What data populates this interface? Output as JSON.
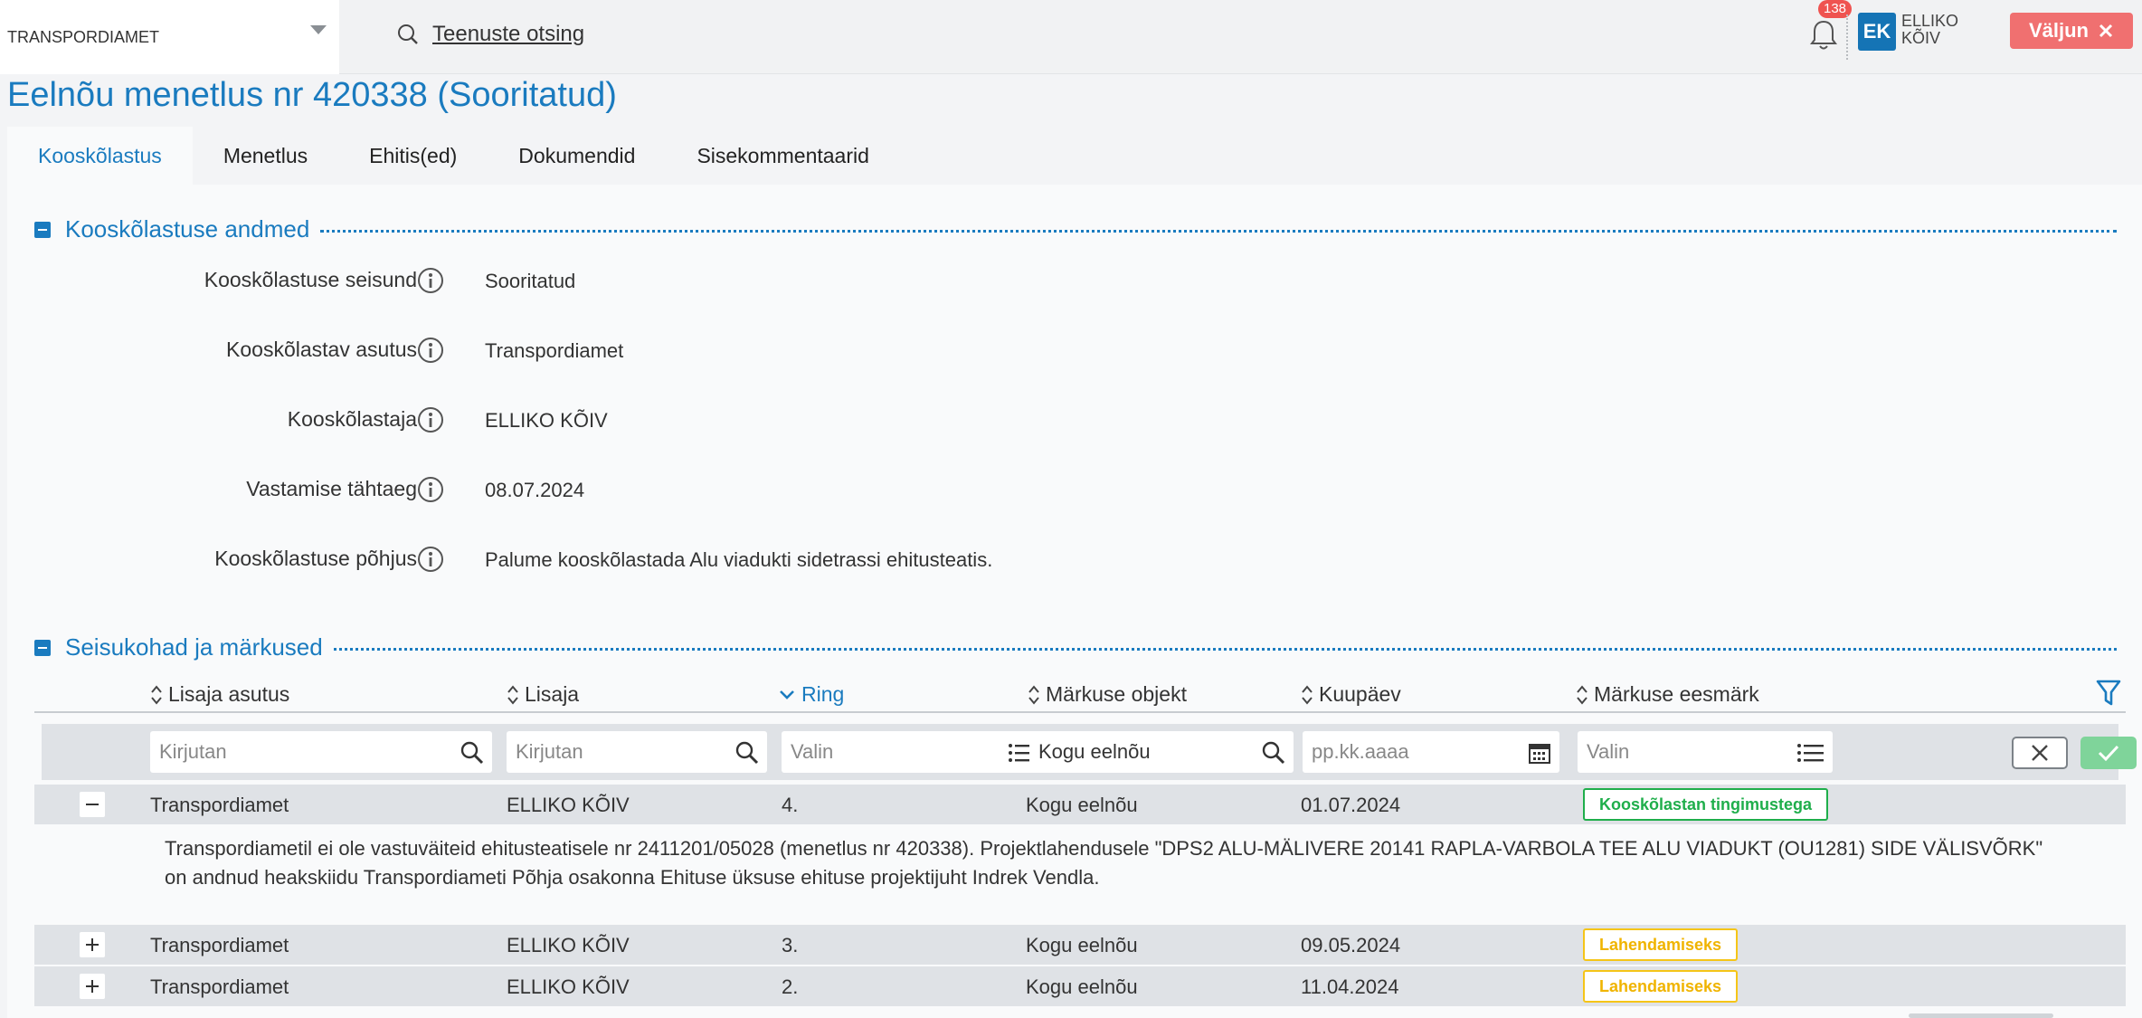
{
  "header": {
    "org_select": "TRANSPORDIAMET",
    "search_label": "Teenuste otsing",
    "notification_count": "138",
    "user_initials": "EK",
    "user_name_line1": "ELLIKO",
    "user_name_line2": "KÕIV",
    "logout_label": "Väljun"
  },
  "page": {
    "title": "Eelnõu menetlus nr 420338 (Sooritatud)"
  },
  "tabs": [
    {
      "label": "Kooskõlastus",
      "active": true
    },
    {
      "label": "Menetlus",
      "active": false
    },
    {
      "label": "Ehitis(ed)",
      "active": false
    },
    {
      "label": "Dokumendid",
      "active": false
    },
    {
      "label": "Sisekommentaarid",
      "active": false
    }
  ],
  "section1": {
    "title": "Kooskõlastuse andmed",
    "fields": [
      {
        "label": "Kooskõlastuse seisund",
        "value": "Sooritatud"
      },
      {
        "label": "Kooskõlastav asutus",
        "value": "Transpordiamet"
      },
      {
        "label": "Kooskõlastaja",
        "value": "ELLIKO KÕIV"
      },
      {
        "label": "Vastamise tähtaeg",
        "value": "08.07.2024"
      },
      {
        "label": "Kooskõlastuse põhjus",
        "value": "Palume kooskõlastada Alu viadukti sidetrassi ehitusteatis."
      }
    ]
  },
  "section2": {
    "title": "Seisukohad ja märkused",
    "columns": [
      {
        "label": "Lisaja asutus",
        "sort": "none"
      },
      {
        "label": "Lisaja",
        "sort": "none"
      },
      {
        "label": "Ring",
        "sort": "desc"
      },
      {
        "label": "Märkuse objekt",
        "sort": "none"
      },
      {
        "label": "Kuupäev",
        "sort": "none"
      },
      {
        "label": "Märkuse eesmärk",
        "sort": "none"
      }
    ],
    "filters": {
      "lisaja_asutus": "Kirjutan",
      "lisaja": "Kirjutan",
      "ring": "Valin",
      "objekt": "Kogu eelnõu",
      "kuupaev": "pp.kk.aaaa",
      "eesmark": "Valin"
    },
    "rows": [
      {
        "expanded": true,
        "asutus": "Transpordiamet",
        "lisaja": "ELLIKO KÕIV",
        "ring": "4.",
        "objekt": "Kogu eelnõu",
        "kuupaev": "01.07.2024",
        "eesmark": "Kooskõlastan tingimustega",
        "tag_color": "green"
      },
      {
        "expanded": false,
        "asutus": "Transpordiamet",
        "lisaja": "ELLIKO KÕIV",
        "ring": "3.",
        "objekt": "Kogu eelnõu",
        "kuupaev": "09.05.2024",
        "eesmark": "Lahendamiseks",
        "tag_color": "yellow"
      },
      {
        "expanded": false,
        "asutus": "Transpordiamet",
        "lisaja": "ELLIKO KÕIV",
        "ring": "2.",
        "objekt": "Kogu eelnõu",
        "kuupaev": "11.04.2024",
        "eesmark": "Lahendamiseks",
        "tag_color": "yellow"
      }
    ],
    "detail_line1": "Transpordiametil ei ole vastuväiteid ehitusteatisele nr 2411201/05028 (menetlus nr 420338). Projektlahendusele \"DPS2 ALU-MÄLIVERE 20141 RAPLA-VARBOLA TEE ALU VIADUKT (OU1281) SIDE VÄLISVÕRK\"",
    "detail_line2": "on andnud heakskiidu Transpordiameti Põhja osakonna Ehituse üksuse ehituse projektijuht Indrek Vendla."
  },
  "colors": {
    "accent": "#1a7bbf",
    "logout": "#f07070",
    "tag_green": "#1fae4b",
    "tag_yellow": "#f5c518"
  }
}
